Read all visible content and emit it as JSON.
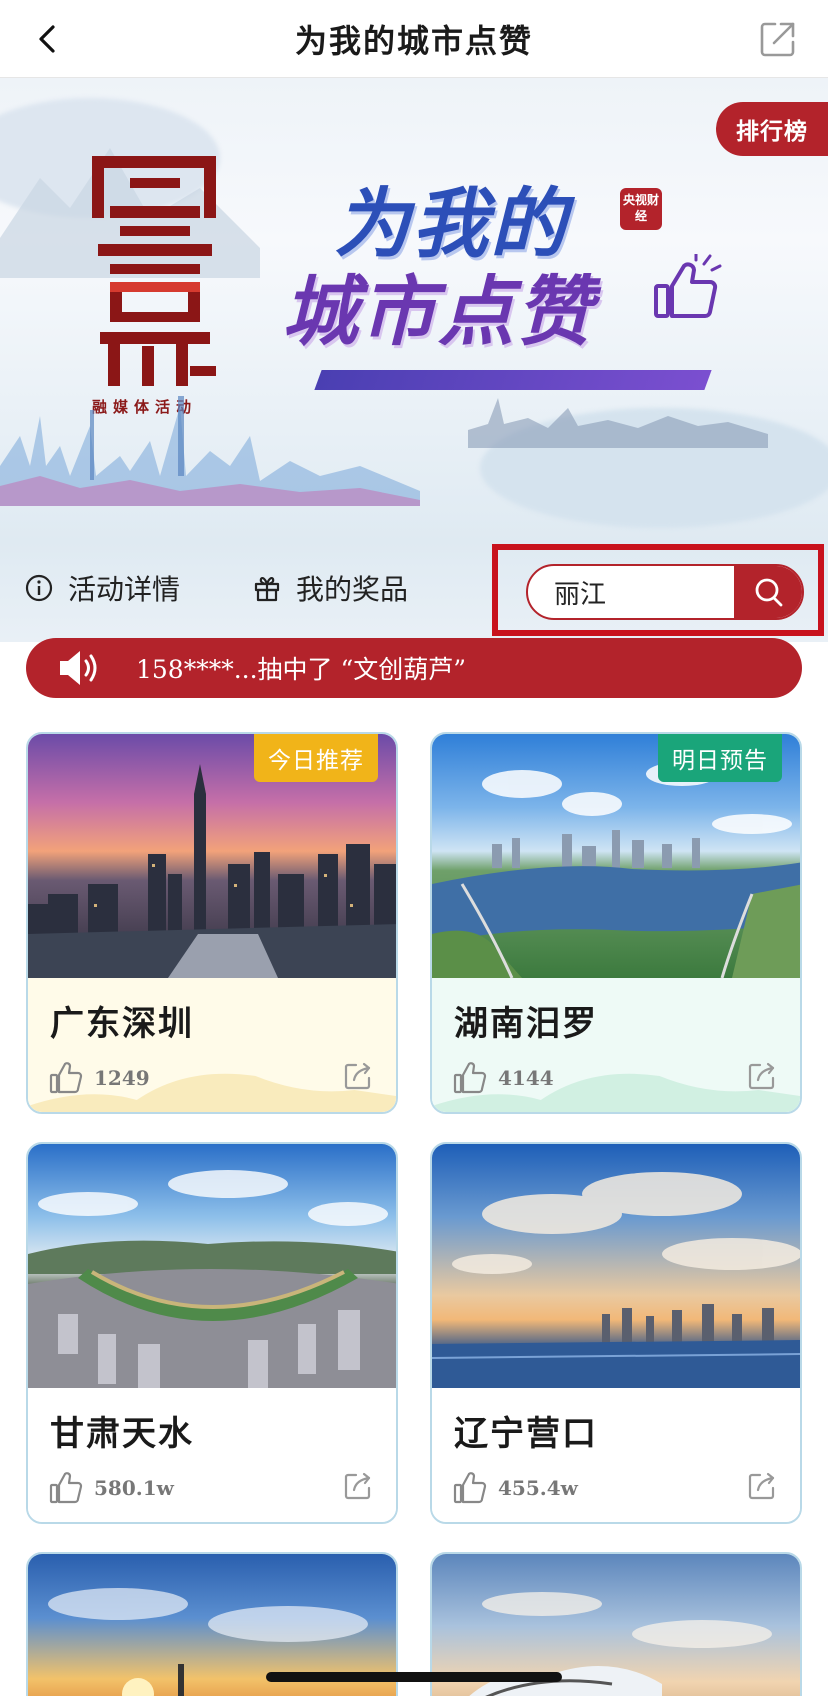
{
  "navbar": {
    "title": "为我的城市点赞"
  },
  "banner": {
    "rank_label": "排行榜",
    "logo_text": "百城百县",
    "logo_subtitle": "融媒体活动",
    "title_line1": "为我的",
    "title_line2": "城市点赞",
    "badge_text": "央视财经"
  },
  "actions": {
    "detail_label": "活动详情",
    "prize_label": "我的奖品"
  },
  "search": {
    "value": "丽江"
  },
  "ticker": {
    "text": "158****...抽中了 “文创葫芦”"
  },
  "cards": [
    {
      "name": "广东深圳",
      "likes": "1249",
      "tag": "今日推荐",
      "tag_color": "#f1b419",
      "theme": "yellow"
    },
    {
      "name": "湖南汨罗",
      "likes": "4144",
      "tag": "明日预告",
      "tag_color": "#1aa57a",
      "theme": "green"
    },
    {
      "name": "甘肃天水",
      "likes": "580.1w",
      "tag": "",
      "theme": "blue"
    },
    {
      "name": "辽宁营口",
      "likes": "455.4w",
      "tag": "",
      "theme": "blue"
    }
  ],
  "colors": {
    "brand_red": "#b3232b",
    "highlight_frame": "#c8121d",
    "card_border": "#b9d9e8"
  }
}
